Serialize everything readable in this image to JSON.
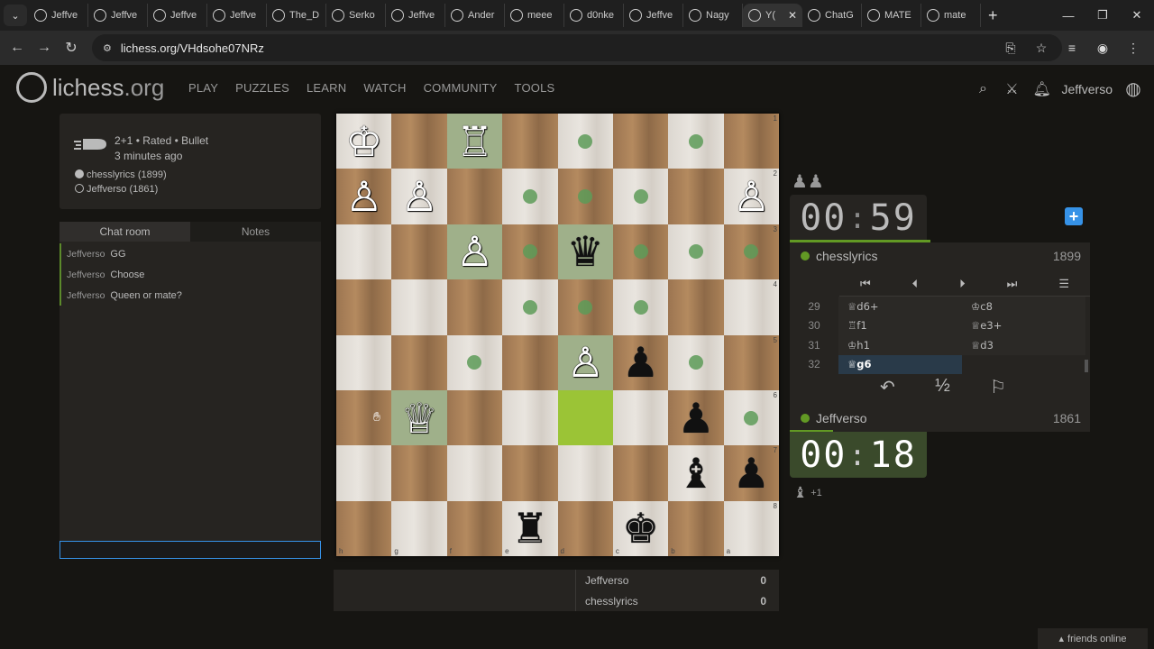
{
  "browser": {
    "tabs": [
      {
        "label": "Jeffve"
      },
      {
        "label": "Jeffve"
      },
      {
        "label": "Jeffve"
      },
      {
        "label": "Jeffve"
      },
      {
        "label": "The_D"
      },
      {
        "label": "Serko"
      },
      {
        "label": "Jeffve"
      },
      {
        "label": "Ander"
      },
      {
        "label": "meee"
      },
      {
        "label": "d0nke"
      },
      {
        "label": "Jeffve"
      },
      {
        "label": "Nagy"
      },
      {
        "label": "Y(",
        "active": true
      },
      {
        "label": "ChatG"
      },
      {
        "label": "MATE"
      },
      {
        "label": "mate"
      }
    ],
    "url": "lichess.org/VHdsohe07NRz"
  },
  "header": {
    "logo_main": "lichess",
    "logo_suffix": ".org",
    "nav": [
      "PLAY",
      "PUZZLES",
      "LEARN",
      "WATCH",
      "COMMUNITY",
      "TOOLS"
    ],
    "username": "Jeffverso"
  },
  "game_info": {
    "type_line": "2+1 • Rated • Bullet",
    "time_ago": "3 minutes ago",
    "white_player": "chesslyrics (1899)",
    "black_player": "Jeffverso (1861)"
  },
  "chat": {
    "tab_chat": "Chat room",
    "tab_notes": "Notes",
    "messages": [
      {
        "user": "Jeffverso",
        "text": "GG"
      },
      {
        "user": "Jeffverso",
        "text": "Choose"
      },
      {
        "user": "Jeffverso",
        "text": "Queen or mate?"
      }
    ]
  },
  "board": {
    "orientation": "black",
    "rank_labels": [
      "1",
      "2",
      "3",
      "4",
      "5",
      "6",
      "7",
      "8"
    ],
    "file_labels": [
      "h",
      "g",
      "f",
      "e",
      "d",
      "c",
      "b",
      "a"
    ],
    "squares": [
      [
        "♔",
        "",
        "♖",
        "",
        "•",
        "",
        "•",
        ""
      ],
      [
        "♙",
        "♙",
        "",
        "•",
        "•",
        "•",
        "",
        "♙"
      ],
      [
        "",
        "",
        "♙",
        "•",
        "♛",
        "•",
        "•",
        "•"
      ],
      [
        "",
        "",
        "",
        "•",
        "•",
        "•",
        "",
        ""
      ],
      [
        "",
        "",
        "•",
        "",
        "♙",
        "♟",
        "•",
        ""
      ],
      [
        "",
        "♕",
        "",
        "",
        "",
        "",
        "♟",
        "•"
      ],
      [
        "",
        "",
        "",
        "",
        "",
        "",
        "♝",
        "♟"
      ],
      [
        "",
        "",
        "",
        "♜",
        "",
        "♚",
        "",
        ""
      ]
    ]
  },
  "score": {
    "p1_name": "Jeffverso",
    "p1_score": "0",
    "p2_name": "chesslyrics",
    "p2_score": "0"
  },
  "clocks": {
    "top_min": "00",
    "top_sec": "59",
    "bot_min": "00",
    "bot_sec": "18"
  },
  "players": {
    "top_name": "chesslyrics",
    "top_rating": "1899",
    "bot_name": "Jeffverso",
    "bot_rating": "1861"
  },
  "moves": [
    {
      "no": "29",
      "white": "♕d6+",
      "black": "♔c8"
    },
    {
      "no": "30",
      "white": "♖f1",
      "black": "♕e3+"
    },
    {
      "no": "31",
      "white": "♔h1",
      "black": "♕d3"
    },
    {
      "no": "32",
      "white": "♕g6",
      "black": ""
    }
  ],
  "material_bottom": "+1",
  "footer": {
    "friends": "friends online"
  },
  "colors": {
    "accent_green": "#629924",
    "move_dot": "#5d9b58",
    "highlight": "#9bc436",
    "blue": "#3692e7"
  }
}
